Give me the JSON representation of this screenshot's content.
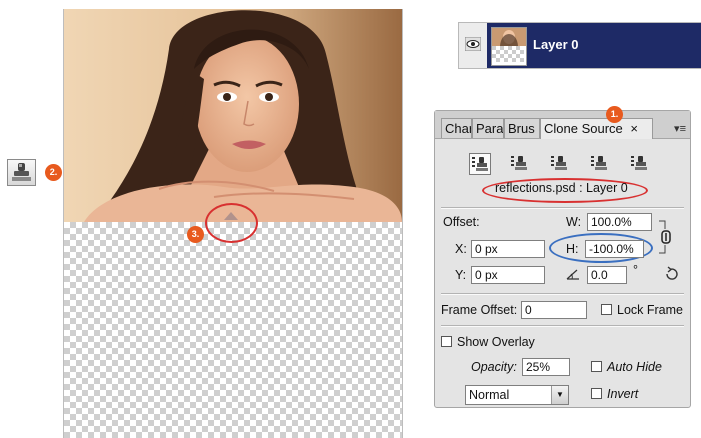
{
  "callouts": {
    "one": "1.",
    "two": "2.",
    "three": "3."
  },
  "layers_panel": {
    "layer_name": "Layer 0"
  },
  "clone_source": {
    "tabs": [
      {
        "label": "Char"
      },
      {
        "label": "Para"
      },
      {
        "label": "Brus"
      },
      {
        "label": "Clone Source"
      }
    ],
    "close_glyph": "×",
    "menu_glyph": "▾≡",
    "source_name": "reflections.psd : Layer 0",
    "offset_label": "Offset:",
    "w_label": "W:",
    "w_value": "100.0%",
    "h_label": "H:",
    "h_value": "-100.0%",
    "x_label": "X:",
    "x_value": "0 px",
    "y_label": "Y:",
    "y_value": "0 px",
    "angle_value": "0.0",
    "degree_glyph": "°",
    "frame_offset_label": "Frame Offset:",
    "frame_offset_value": "0",
    "lock_frame_label": "Lock Frame",
    "show_overlay_label": "Show Overlay",
    "opacity_label": "Opacity:",
    "opacity_value": "25%",
    "auto_hide_label": "Auto Hide",
    "blend_mode": "Normal",
    "invert_label": "Invert"
  },
  "colors": {
    "accent_orange": "#e85a1e",
    "ring_red": "#d83030",
    "ring_blue": "#3a6fc0",
    "layer_selected": "#1e2a66"
  }
}
